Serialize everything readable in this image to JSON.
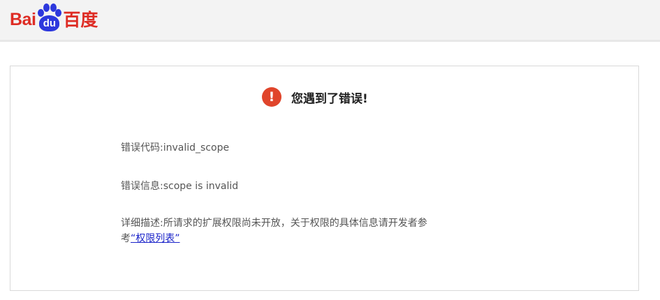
{
  "header": {
    "logo": {
      "text_left": "Bai",
      "paw_text": "du",
      "text_cn": "百度"
    }
  },
  "error": {
    "heading": "您遇到了错误!",
    "icon": "exclamation-icon",
    "code_label": "错误代码:",
    "code_value": "invalid_scope",
    "info_label": "错误信息:",
    "info_value": "scope is invalid",
    "desc_label": "详细描述:",
    "desc_line1": "所请求的扩展权限尚未开放，关于权限的具体信息请开发者参",
    "desc_line2_prefix": "考",
    "link_text": "“权限列表”"
  },
  "colors": {
    "brand_red": "#de2c24",
    "brand_blue": "#2d38dd",
    "error_icon": "#e0452b",
    "link": "#1a23c9"
  }
}
